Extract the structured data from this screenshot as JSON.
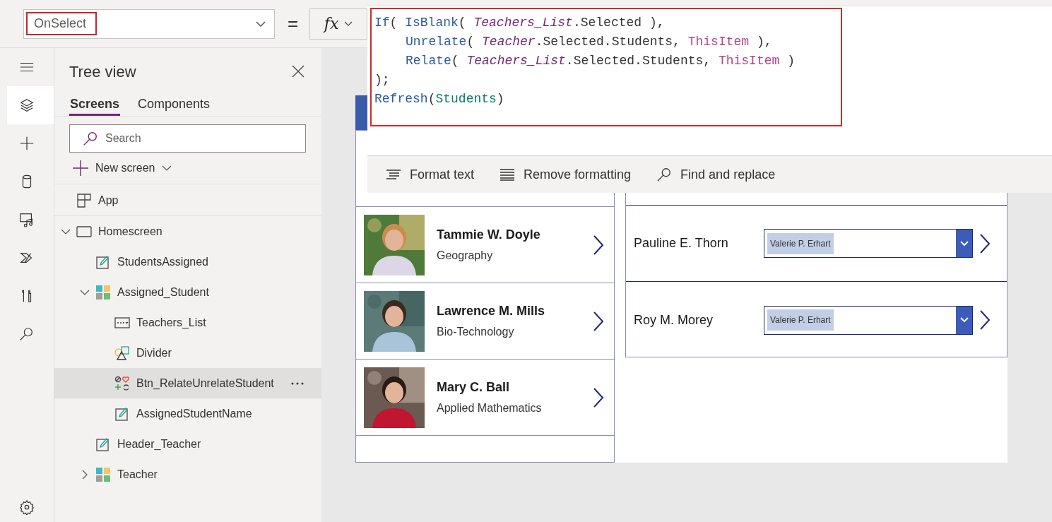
{
  "property_bar": {
    "property": "OnSelect",
    "equals": "=",
    "fx": "fx"
  },
  "formula": {
    "lines": [
      {
        "indented": false,
        "tokens": [
          {
            "text": "If",
            "kind": "function"
          },
          {
            "text": "( ",
            "kind": "plain"
          },
          {
            "text": "IsBlank",
            "kind": "function"
          },
          {
            "text": "( ",
            "kind": "plain"
          },
          {
            "text": "Teachers_List",
            "kind": "control"
          },
          {
            "text": ".Selected ),",
            "kind": "plain"
          }
        ]
      },
      {
        "indented": true,
        "tokens": [
          {
            "text": "Unrelate",
            "kind": "function"
          },
          {
            "text": "( ",
            "kind": "plain"
          },
          {
            "text": "Teacher",
            "kind": "control"
          },
          {
            "text": ".Selected.Students, ",
            "kind": "plain"
          },
          {
            "text": "ThisItem",
            "kind": "keyword"
          },
          {
            "text": " ),",
            "kind": "plain"
          }
        ]
      },
      {
        "indented": true,
        "tokens": [
          {
            "text": "Relate",
            "kind": "function"
          },
          {
            "text": "( ",
            "kind": "plain"
          },
          {
            "text": "Teachers_List",
            "kind": "control"
          },
          {
            "text": ".Selected.Students, ",
            "kind": "plain"
          },
          {
            "text": "ThisItem",
            "kind": "keyword"
          },
          {
            "text": " )",
            "kind": "plain"
          }
        ]
      },
      {
        "indented": false,
        "tokens": [
          {
            "text": ");",
            "kind": "plain"
          }
        ]
      },
      {
        "indented": false,
        "tokens": [
          {
            "text": "Refresh",
            "kind": "function"
          },
          {
            "text": "(",
            "kind": "plain"
          },
          {
            "text": "Students",
            "kind": "datasource"
          },
          {
            "text": ")",
            "kind": "plain"
          }
        ]
      }
    ],
    "toolbar": [
      {
        "label": "Format text",
        "kind": "format"
      },
      {
        "label": "Remove formatting",
        "kind": "remove"
      },
      {
        "label": "Find and replace",
        "kind": "find"
      }
    ]
  },
  "rail": [
    {
      "kind": "menu",
      "selected": false
    },
    {
      "kind": "layers",
      "selected": true
    },
    {
      "kind": "insert",
      "selected": false
    },
    {
      "kind": "data",
      "selected": false
    },
    {
      "kind": "media",
      "selected": false
    },
    {
      "kind": "flow",
      "selected": false
    },
    {
      "kind": "tools",
      "selected": false
    },
    {
      "kind": "search",
      "selected": false
    },
    {
      "kind": "settings",
      "selected": false
    }
  ],
  "tree_view": {
    "title": "Tree view",
    "tabs": [
      {
        "label": "Screens",
        "selected": true
      },
      {
        "label": "Components",
        "selected": false
      }
    ],
    "search": {
      "placeholder": "Search"
    },
    "new_screen": "New screen",
    "items": [
      {
        "label": "App",
        "kind": "app",
        "selected": false
      },
      {
        "label": "Homescreen",
        "kind": "screen",
        "expanded": true,
        "selected": false,
        "children": [
          {
            "label": "StudentsAssigned",
            "kind": "label",
            "selected": false
          },
          {
            "label": "Assigned_Student",
            "kind": "gallery",
            "expanded": true,
            "selected": false,
            "children": [
              {
                "label": "Teachers_List",
                "kind": "dropdown",
                "selected": false
              },
              {
                "label": "Divider",
                "kind": "shapes",
                "selected": false
              },
              {
                "label": "Btn_RelateUnrelateStudent",
                "kind": "button",
                "selected": true
              },
              {
                "label": "AssignedStudentName",
                "kind": "label",
                "selected": false
              }
            ]
          },
          {
            "label": "Header_Teacher",
            "kind": "label",
            "selected": false
          },
          {
            "label": "Teacher",
            "kind": "gallery",
            "expanded": false,
            "selected": false
          }
        ]
      }
    ]
  },
  "canvas": {
    "teachers": [
      {
        "name": "Tammie W. Doyle",
        "subject": "Geography",
        "kind": "picture"
      },
      {
        "name": "Lawrence M. Mills",
        "subject": "Bio-Technology",
        "kind": "picture"
      },
      {
        "name": "Mary C. Ball",
        "subject": "Applied Mathematics",
        "kind": "picture"
      }
    ],
    "students": [
      {
        "name": "Pauline E. Thorn",
        "teacher": "Valerie P. Erhart"
      },
      {
        "name": "Roy M. Morey",
        "teacher": "Valerie P. Erhart"
      }
    ]
  }
}
